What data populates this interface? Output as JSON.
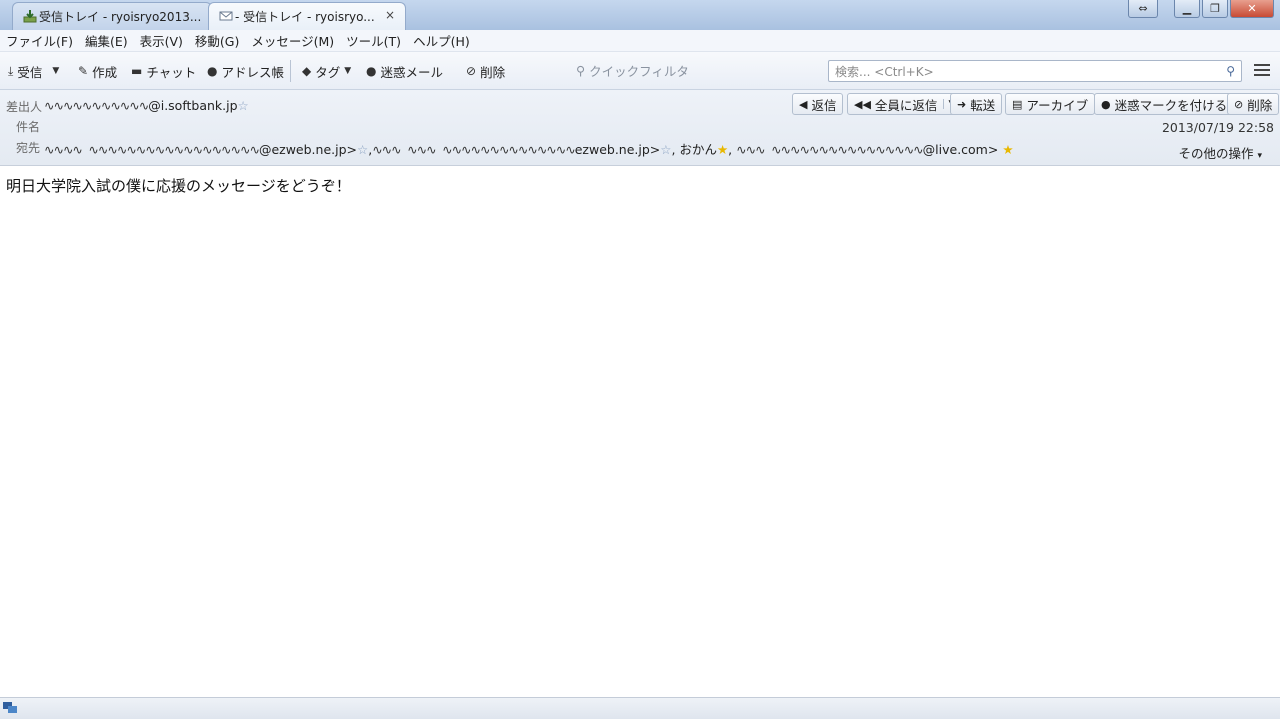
{
  "tabs": [
    {
      "title": "受信トレイ - ryoisryo2013...",
      "icon": "inbox-download-icon"
    },
    {
      "title": "- 受信トレイ - ryoisryo...",
      "icon": "envelope-icon",
      "close": "×"
    }
  ],
  "menu": [
    "ファイル(F)",
    "編集(E)",
    "表示(V)",
    "移動(G)",
    "メッセージ(M)",
    "ツール(T)",
    "ヘルプ(H)"
  ],
  "toolbar": {
    "get": "受信",
    "write": "作成",
    "chat": "チャット",
    "address_book": "アドレス帳",
    "tag": "タグ",
    "junk": "迷惑メール",
    "delete": "削除",
    "quick_filter": "クイックフィルタ",
    "search_placeholder": "検索... <Ctrl+K>"
  },
  "header": {
    "from_label": "差出人",
    "from_value": "@i.softbank.jp",
    "subject_label": "件名",
    "to_label": "宛先",
    "to_1": "@ezweb.ne.jp>",
    "to_2": "ezweb.ne.jp>",
    "to_3": ", おかん",
    "to_4": "@live.com>",
    "reply": "返信",
    "reply_all": "全員に返信",
    "forward": "転送",
    "archive": "アーカイブ",
    "junk": "迷惑マークを付ける",
    "delete": "削除",
    "date": "2013/07/19 22:58",
    "other_actions": "その他の操作"
  },
  "body_text": "明日大学院入試の僕に応援のメッセージをどうぞ！"
}
